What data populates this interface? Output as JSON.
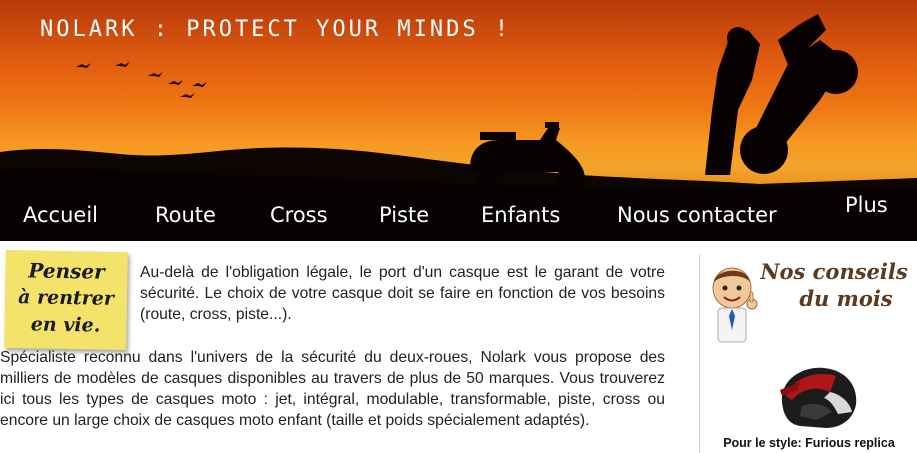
{
  "header": {
    "site_title": "NOLARK : PROTECT YOUR MINDS !"
  },
  "nav": {
    "items": [
      {
        "label": "Accueil"
      },
      {
        "label": "Route"
      },
      {
        "label": "Cross"
      },
      {
        "label": "Piste"
      },
      {
        "label": "Enfants"
      },
      {
        "label": "Nous contacter"
      },
      {
        "label": "Plus"
      }
    ]
  },
  "postit": {
    "lines": [
      "Penser",
      "à rentrer",
      "en vie."
    ]
  },
  "main": {
    "paragraph_1": "Au-delà de l'obligation légale, le port d'un casque est le garant de votre sécurité. Le choix de votre casque doit se faire en fonction de vos besoins (route, cross, piste...).",
    "paragraph_2": "Spécialiste reconnu dans l'univers de la sécurité du deux-roues, Nolark vous propose des milliers de modèles de casques disponibles au travers de plus de 50 marques. Vous trouverez ici tous les types de casques moto : jet, intégral, modulable, transformable, piste, cross ou encore un large choix de casques moto enfant (taille et poids spécialement adaptés)."
  },
  "aside": {
    "title_line_1": "Nos conseils",
    "title_line_2": "du mois",
    "caption": "Pour le style: Furious replica"
  },
  "colors": {
    "nav_background": "#000000",
    "postit": "#f3e36a",
    "sunset_orange": "#f07a14"
  },
  "icons": [
    "advisor-character-icon",
    "helmet-image"
  ]
}
